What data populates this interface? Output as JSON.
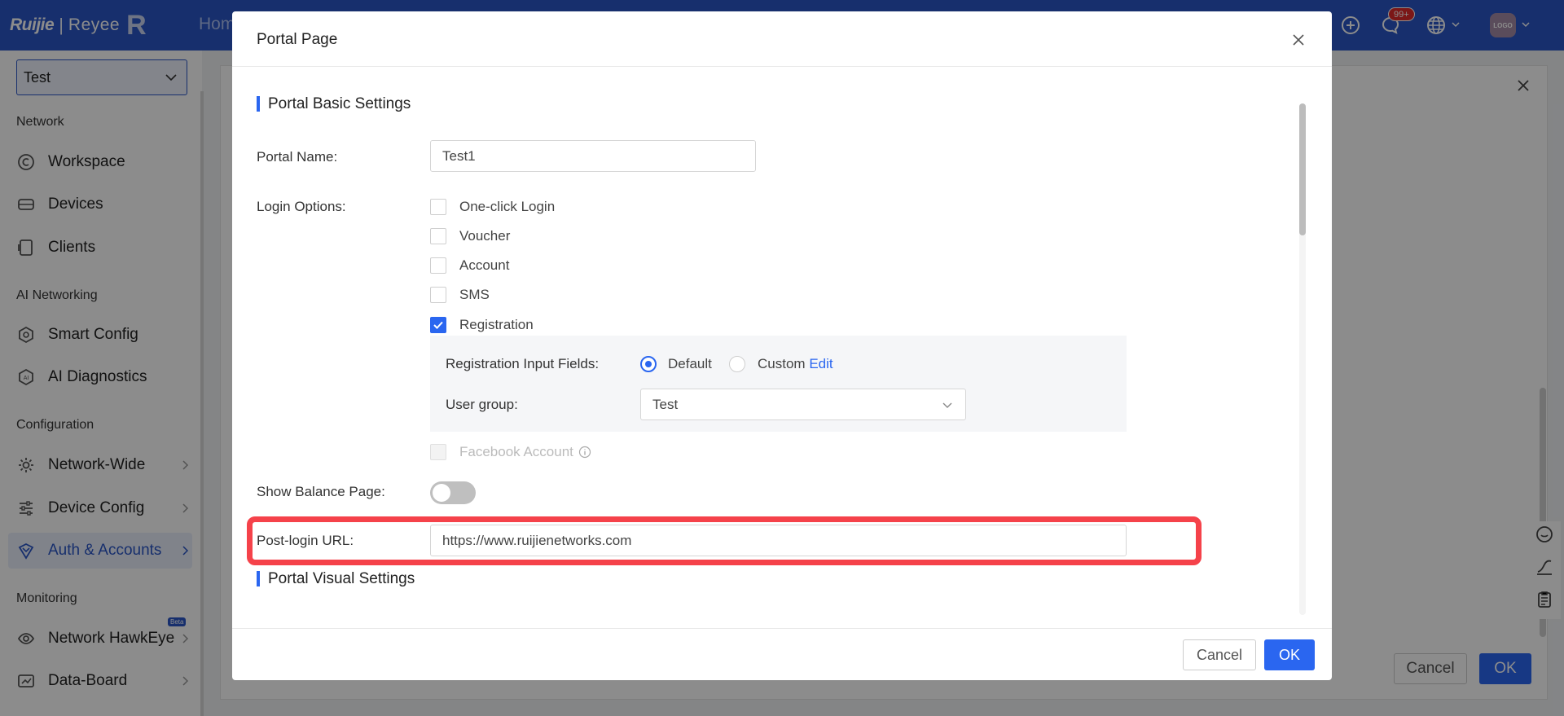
{
  "header": {
    "brand_left": "Ruijie",
    "brand_right": "Reyee",
    "brand_mark": "R",
    "nav_home": "Hom",
    "notification_badge": "99+",
    "avatar_label": "LOGO"
  },
  "sidebar": {
    "project_select": "Test",
    "sections": {
      "network": "Network",
      "ai_networking": "AI Networking",
      "configuration": "Configuration",
      "monitoring": "Monitoring"
    },
    "items": {
      "workspace": "Workspace",
      "devices": "Devices",
      "clients": "Clients",
      "smart_config": "Smart Config",
      "ai_diagnostics": "AI Diagnostics",
      "network_wide": "Network-Wide",
      "device_config": "Device Config",
      "auth_accounts": "Auth & Accounts",
      "network_hawkeye": "Network HawkEye",
      "data_board": "Data-Board"
    },
    "beta_badge": "Beta"
  },
  "background_panel": {
    "cancel_label": "Cancel",
    "ok_label": "OK"
  },
  "modal": {
    "title": "Portal Page",
    "basic_section": "Portal Basic Settings",
    "portal_name_label": "Portal Name:",
    "portal_name_value": "Test1",
    "login_options_label": "Login Options:",
    "options": {
      "one_click": "One-click Login",
      "voucher": "Voucher",
      "account": "Account",
      "sms": "SMS",
      "registration": "Registration",
      "facebook": "Facebook Account"
    },
    "registration_fields_label": "Registration Input Fields:",
    "radio_default": "Default",
    "radio_custom": "Custom",
    "edit_link": "Edit",
    "user_group_label": "User group:",
    "user_group_value": "Test",
    "show_balance_label": "Show Balance Page:",
    "post_login_label": "Post-login URL:",
    "post_login_value": "https://www.ruijienetworks.com",
    "visual_section": "Portal Visual Settings",
    "cancel_label": "Cancel",
    "ok_label": "OK"
  },
  "colors": {
    "brand_blue": "#2a56c6",
    "primary_button": "#2a66f0",
    "highlight_red": "#f5424a"
  }
}
